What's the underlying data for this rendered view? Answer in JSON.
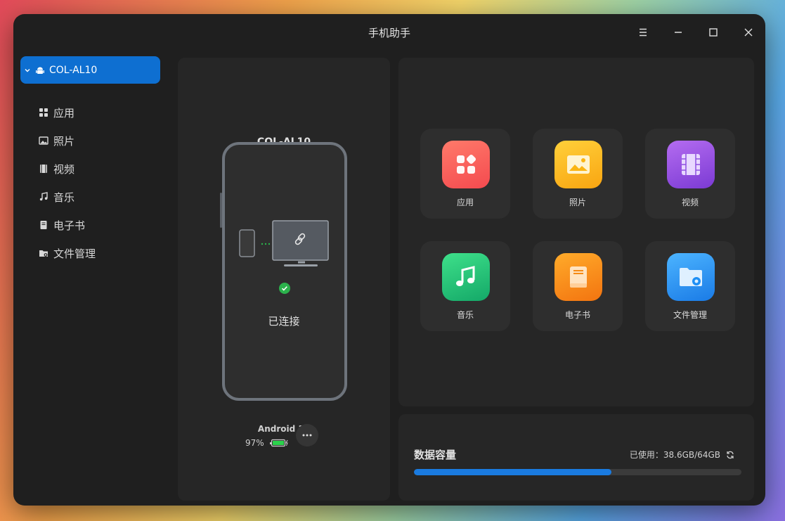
{
  "window": {
    "title": "手机助手"
  },
  "sidebar": {
    "device": {
      "label": "COL-AL10",
      "icon": "android-icon"
    },
    "items": [
      {
        "label": "应用",
        "icon": "apps-icon"
      },
      {
        "label": "照片",
        "icon": "photo-icon"
      },
      {
        "label": "视频",
        "icon": "video-icon"
      },
      {
        "label": "音乐",
        "icon": "music-icon"
      },
      {
        "label": "电子书",
        "icon": "ebook-icon"
      },
      {
        "label": "文件管理",
        "icon": "folder-icon"
      }
    ]
  },
  "device_panel": {
    "name": "COL-AL10",
    "status": "已连接",
    "os": "Android 10",
    "battery": "97%"
  },
  "grid": {
    "tiles": [
      {
        "label": "应用",
        "icon": "apps-icon",
        "color": "#f85a5a"
      },
      {
        "label": "照片",
        "icon": "photo-icon",
        "color": "#fbb512"
      },
      {
        "label": "视频",
        "icon": "video-icon",
        "color": "#9750e0"
      },
      {
        "label": "音乐",
        "icon": "music-icon",
        "color": "#23c173"
      },
      {
        "label": "电子书",
        "icon": "ebook-icon",
        "color": "#fb8a10"
      },
      {
        "label": "文件管理",
        "icon": "folder-icon",
        "color": "#1e8ff5"
      }
    ]
  },
  "storage": {
    "title": "数据容量",
    "usage": "已使用：38.6GB/64GB",
    "used_fraction": 0.603
  },
  "colors": {
    "accent": "#0e6fd1",
    "connected": "#2bb24c"
  }
}
